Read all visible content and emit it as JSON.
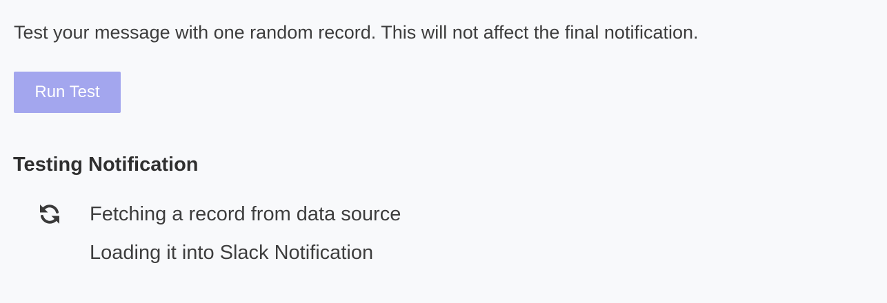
{
  "test": {
    "description": "Test your message with one random record. This will not affect the final notification.",
    "run_button_label": "Run Test"
  },
  "testing_section": {
    "title": "Testing Notification",
    "steps": [
      {
        "label": "Fetching a record from data source",
        "icon": "refresh-icon",
        "status": "in-progress"
      },
      {
        "label": "Loading it into Slack Notification",
        "icon": "",
        "status": "pending"
      }
    ]
  },
  "colors": {
    "background": "#f8f9fb",
    "button_disabled": "#a3a6ee",
    "text": "#3d3d3d"
  }
}
